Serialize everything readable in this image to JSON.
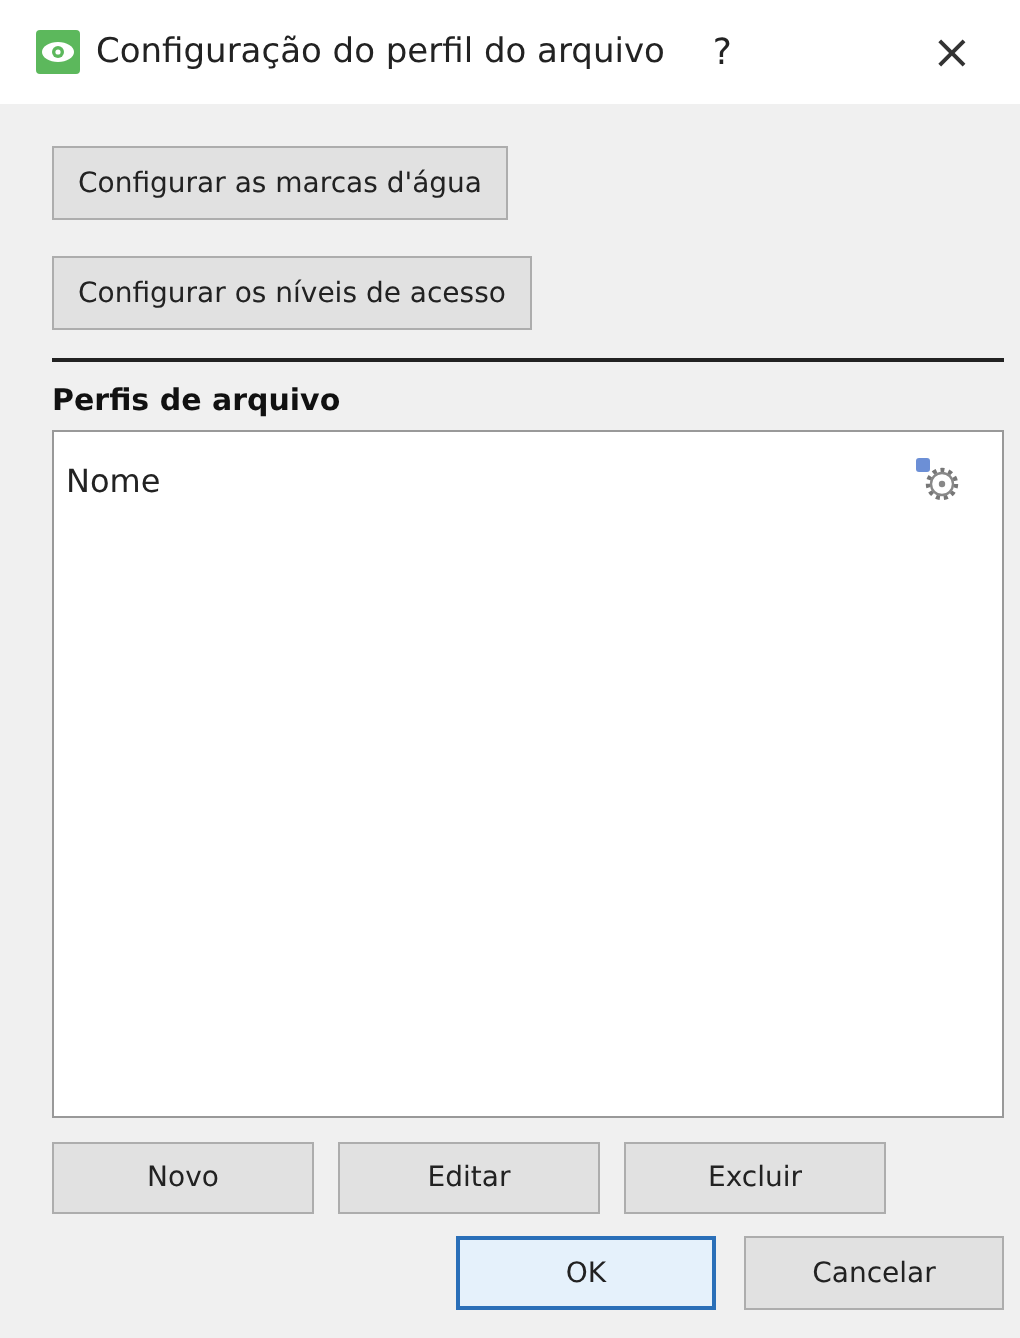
{
  "window": {
    "title": "Configuração do perfil do arquivo",
    "help": "?",
    "close": "×"
  },
  "config_buttons": [
    "Configurar as marcas d'água",
    "Configurar os níveis de acesso"
  ],
  "section_title": "Perfis de arquivo",
  "list": {
    "columns": [
      "Nome"
    ]
  },
  "list_buttons": [
    "Novo",
    "Editar",
    "Excluir"
  ],
  "dialog_buttons": [
    {
      "label": "OK",
      "default": true
    },
    {
      "label": "Cancelar",
      "default": false
    }
  ]
}
